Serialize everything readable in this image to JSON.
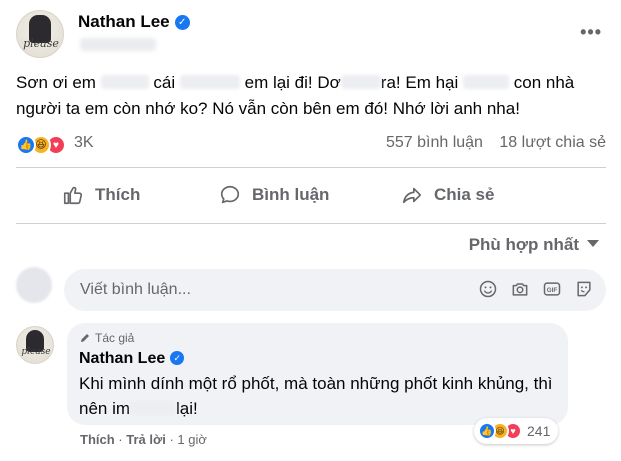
{
  "post": {
    "author": "Nathan Lee",
    "avatar_text": "please",
    "more_label": "•••",
    "text_parts": [
      "Sơn ơi em",
      "cái",
      "em lại đi! Dơ",
      "ra! Em hại",
      "con nhà người ta em còn nhớ ko? Nó vẫn còn bên em đó! Nhớ lời anh nha!"
    ],
    "reaction_count": "3K",
    "comments_count": "557 bình luận",
    "shares_count": "18 lượt chia sẻ",
    "reaction_icons": [
      "like-icon",
      "haha-icon",
      "love-icon"
    ]
  },
  "actions": {
    "like_label": "Thích",
    "comment_label": "Bình luận",
    "share_label": "Chia sẻ"
  },
  "comments_section": {
    "sort_label": "Phù hợp nhất",
    "compose_placeholder": "Viết bình luận...",
    "compose_icons": [
      "emoji-icon",
      "camera-icon",
      "gif-icon",
      "sticker-icon"
    ]
  },
  "reply": {
    "author_tag": "Tác giả",
    "author": "Nathan Lee",
    "text_parts": [
      "Khi mình dính một rổ phốt, mà toàn những phốt kinh khủng, thì nên im",
      "lại!"
    ],
    "reaction_count": "241",
    "like_label": "Thích",
    "reply_label": "Trả lời",
    "time": "1 giờ"
  },
  "colors": {
    "accent": "#1877f2",
    "muted_text": "#65676b",
    "bubble": "#f0f2f5",
    "love": "#f33e58",
    "haha": "#f7b125"
  }
}
